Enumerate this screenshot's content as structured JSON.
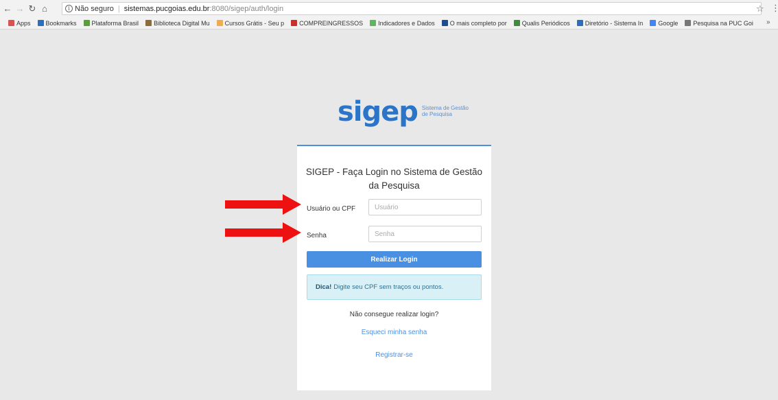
{
  "browser": {
    "security_label": "Não seguro",
    "url_host": "sistemas.pucgoias.edu.br",
    "url_path": ":8080/sigep/auth/login",
    "bookmarks": [
      {
        "label": "Apps",
        "color": "#d9534f"
      },
      {
        "label": "Bookmarks",
        "color": "#2a6fbd"
      },
      {
        "label": "Plataforma Brasil",
        "color": "#5a9e3c"
      },
      {
        "label": "Biblioteca Digital Mu",
        "color": "#8a6d3b"
      },
      {
        "label": "Cursos Grátis - Seu p",
        "color": "#f0ad4e"
      },
      {
        "label": "COMPREINGRESSOS",
        "color": "#c9302c"
      },
      {
        "label": "Indicadores e Dados",
        "color": "#5cb85c"
      },
      {
        "label": "O mais completo por",
        "color": "#1f4e8c"
      },
      {
        "label": "Qualis Periódicos",
        "color": "#3c8d3c"
      },
      {
        "label": "Diretório - Sistema In",
        "color": "#2a6fbd"
      },
      {
        "label": "Google",
        "color": "#4285f4"
      },
      {
        "label": "Pesquisa na PUC Goi",
        "color": "#777777"
      }
    ],
    "more_label": "»"
  },
  "logo": {
    "word": "sigep",
    "sub_line1": "Sistema de Gestão",
    "sub_line2": "de Pesquisa"
  },
  "login": {
    "title": "SIGEP - Faça Login no Sistema de Gestão da Pesquisa",
    "user_label": "Usuário ou CPF",
    "user_placeholder": "Usuário",
    "password_label": "Senha",
    "password_placeholder": "Senha",
    "submit_label": "Realizar Login",
    "tip_strong": "Dica!",
    "tip_text": "Digite seu CPF sem traços ou pontos.",
    "help_question": "Não consegue realizar login?",
    "forgot_link": "Esqueci minha senha",
    "register_link": "Registrar-se"
  },
  "colors": {
    "accent": "#4a90e2",
    "arrow": "#ee1111"
  }
}
